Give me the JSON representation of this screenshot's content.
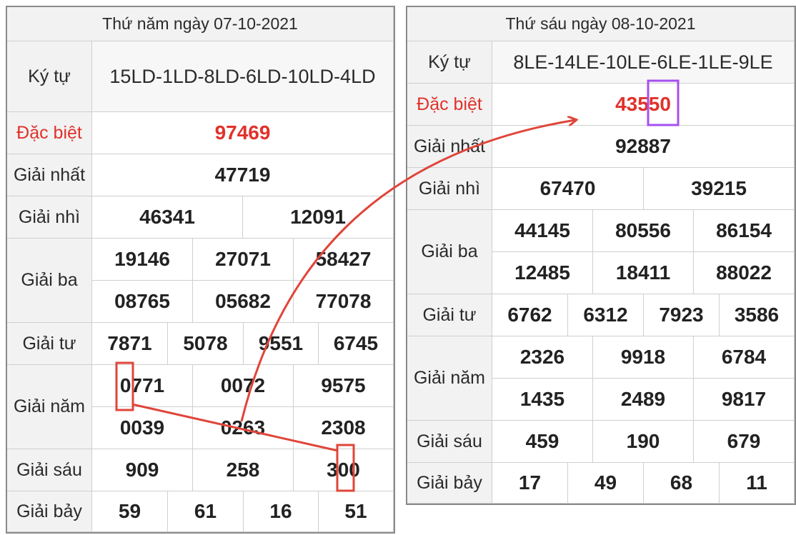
{
  "left": {
    "header": "Thứ năm ngày 07-10-2021",
    "rows": {
      "ky_tu": {
        "label": "Ký tự",
        "value": "15LD-1LD-8LD-6LD-10LD-4LD"
      },
      "dac_biet": {
        "label": "Đặc biệt",
        "value": "97469"
      },
      "giai_nhat": {
        "label": "Giải nhất",
        "value": "47719"
      },
      "giai_nhi": {
        "label": "Giải nhì",
        "values": [
          "46341",
          "12091"
        ]
      },
      "giai_ba": {
        "label": "Giải ba",
        "values": [
          "19146",
          "27071",
          "58427",
          "08765",
          "05682",
          "77078"
        ]
      },
      "giai_tu": {
        "label": "Giải tư",
        "values": [
          "7871",
          "5078",
          "9551",
          "6745"
        ]
      },
      "giai_nam": {
        "label": "Giải năm",
        "values": [
          "0771",
          "0072",
          "9575",
          "0039",
          "0263",
          "2308"
        ]
      },
      "giai_sau": {
        "label": "Giải sáu",
        "values": [
          "909",
          "258",
          "300"
        ]
      },
      "giai_bay": {
        "label": "Giải bảy",
        "values": [
          "59",
          "61",
          "16",
          "51"
        ]
      }
    }
  },
  "right": {
    "header": "Thứ sáu ngày 08-10-2021",
    "rows": {
      "ky_tu": {
        "label": "Ký tự",
        "value": "8LE-14LE-10LE-6LE-1LE-9LE"
      },
      "dac_biet": {
        "label": "Đặc biệt",
        "value": "43550"
      },
      "giai_nhat": {
        "label": "Giải nhất",
        "value": "92887"
      },
      "giai_nhi": {
        "label": "Giải nhì",
        "values": [
          "67470",
          "39215"
        ]
      },
      "giai_ba": {
        "label": "Giải ba",
        "values": [
          "44145",
          "80556",
          "86154",
          "12485",
          "18411",
          "88022"
        ]
      },
      "giai_tu": {
        "label": "Giải tư",
        "values": [
          "6762",
          "6312",
          "7923",
          "3586"
        ]
      },
      "giai_nam": {
        "label": "Giải năm",
        "values": [
          "2326",
          "9918",
          "6784",
          "1435",
          "2489",
          "9817"
        ]
      },
      "giai_sau": {
        "label": "Giải sáu",
        "values": [
          "459",
          "190",
          "679"
        ]
      },
      "giai_bay": {
        "label": "Giải bảy",
        "values": [
          "17",
          "49",
          "68",
          "11"
        ]
      }
    }
  },
  "annotations": {
    "highlight_red": "#e0453a",
    "highlight_purple": "#a64ff0"
  }
}
